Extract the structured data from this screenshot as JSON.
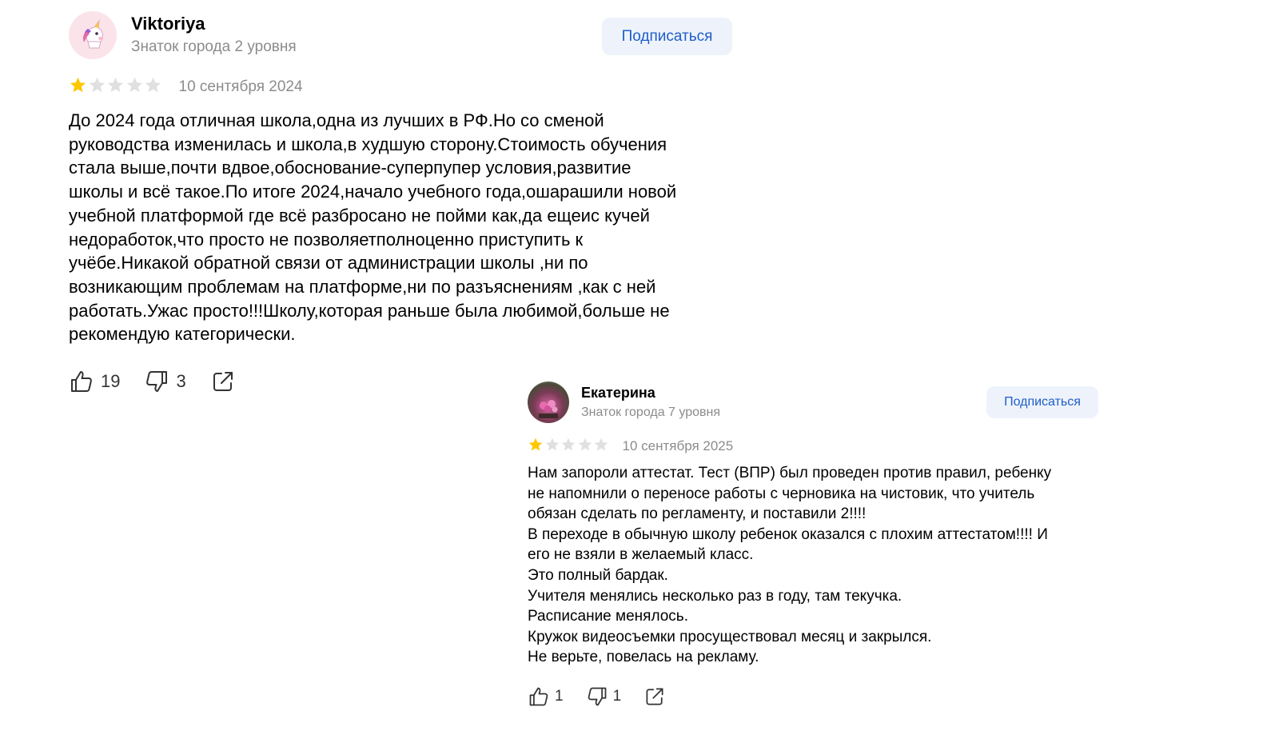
{
  "colors": {
    "star_filled": "#fcc700",
    "star_empty": "#e0e0e0",
    "accent": "#1e5ec8",
    "secondary_text": "#8c8c8c"
  },
  "reviews": [
    {
      "author": "Viktoriya",
      "level": "Знаток города 2 уровня",
      "avatar_icon": "unicorn-emoji",
      "subscribe_label": "Подписаться",
      "rating": 1,
      "rating_max": 5,
      "date": "10 сентября 2024",
      "text": "До 2024 года отличная школа,одна из лучших в РФ.Но со сменой\nруководства изменилась и школа,в худшую сторону.Стоимость обучения\nстала выше,почти вдвое,обоснование-суперпупер условия,развитие\nшколы и всё такое.По итоге 2024,начало учебного года,ошарашили новой\nучебной платформой где всё разбросано не пойми как,да ещеис кучей\nнедоработок,что просто не позволяетполноценно приступить к\nучёбе.Никакой обратной связи от администрации школы ,ни по\nвозникающим проблемам на платформе,ни по разъяснениям ,как с ней\nработать.Ужас просто!!!Школу,которая раньше была любимой,больше не\nрекомендую категорически.",
      "likes": "19",
      "dislikes": "3"
    },
    {
      "author": "Екатерина",
      "level": "Знаток города 7 уровня",
      "avatar_icon": "flowers-photo",
      "subscribe_label": "Подписаться",
      "rating": 1,
      "rating_max": 5,
      "date": "10 сентября 2025",
      "text": "Нам запороли аттестат. Тест (ВПР) был проведен против правил, ребенку\nне напомнили о переносе работы с черновика на чистовик, что учитель\nобязан сделать по регламенту, и поставили 2!!!!\nВ переходе в обычную школу ребенок оказался с плохим аттестатом!!!! И\nего не взяли в желаемый класс.\nЭто полный бардак.\nУчителя менялись несколько раз в году, там текучка.\nРасписание менялось.\nКружок видеосъемки просуществовал месяц и закрылся.\nНе верьте, повелась на рекламу.",
      "likes": "1",
      "dislikes": "1"
    }
  ]
}
